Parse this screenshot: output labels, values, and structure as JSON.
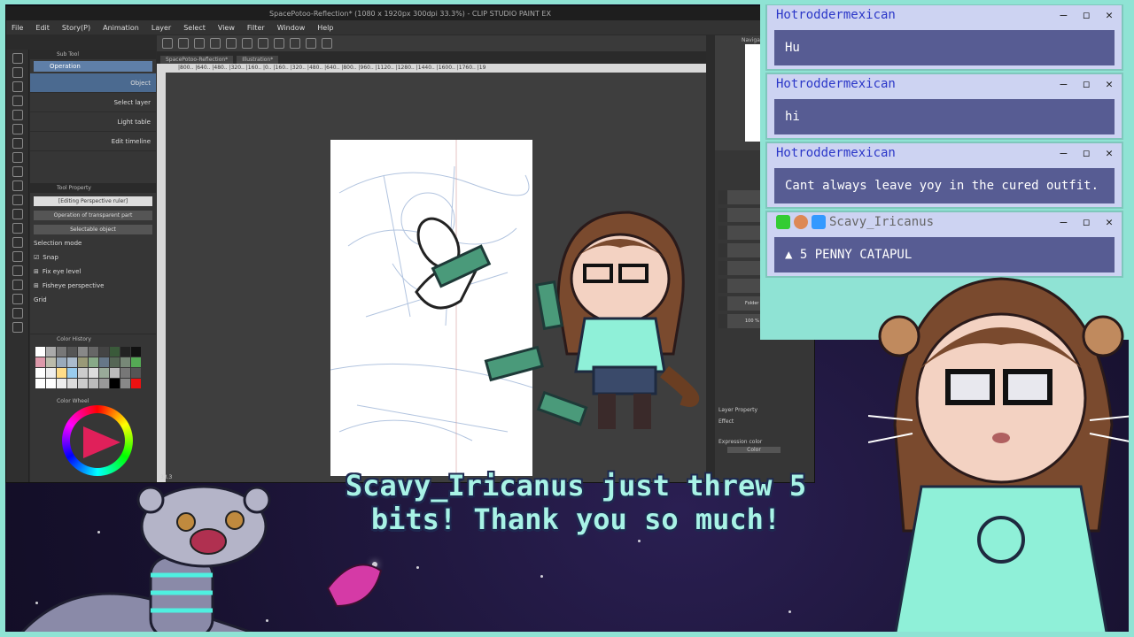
{
  "csp": {
    "title": "SpacePotoo-Reflection* (1080 x 1920px 300dpi 33.3%) - CLIP STUDIO PAINT EX",
    "menu": [
      "File",
      "Edit",
      "Story(P)",
      "Animation",
      "Layer",
      "Select",
      "View",
      "Filter",
      "Window",
      "Help"
    ],
    "subtool": {
      "header": "Sub Tool",
      "selected": "Operation",
      "items": [
        "Object",
        "Select layer",
        "Light table",
        "Edit timeline"
      ]
    },
    "toolprop": {
      "header": "Tool Property",
      "editing": "[Editing Perspective ruler]",
      "option1": "Operation of transparent part",
      "option2": "Selectable object",
      "selection_mode": "Selection mode",
      "checks": [
        "Snap",
        "Fix eye level",
        "Fisheye perspective"
      ],
      "grid": "Grid"
    },
    "color_history": "Color History",
    "color_wheel": "Color Wheel",
    "tabs": [
      "SpacePotoo-Reflection*",
      "Illustration*"
    ],
    "ruler_text": "|800.. |640.. |480.. |320.. |160.. |0.. |160.. |320.. |480.. |640.. |800.. |960.. |1120.. |1280.. |1440.. |1600.. |1760.. |19",
    "zoom": "33.3",
    "navigator": "Navigat",
    "layer_labels": [
      "100 % Nor",
      "Folder 10",
      "100 % Nor Perspective"
    ],
    "layer_property": "Layer Property",
    "effect": "Effect",
    "expression_color": "Expression color",
    "color_label": "Color"
  },
  "chat": {
    "messages": [
      {
        "user": "Hotroddermexican",
        "text": "Hu"
      },
      {
        "user": "Hotroddermexican",
        "text": "hi"
      },
      {
        "user": "Hotroddermexican",
        "text": "Cant always leave yoy in the cured outfit."
      },
      {
        "user": "Scavy_Iricanus",
        "text": "5 PENNY CATAPUL"
      }
    ],
    "ctrl_min": "–",
    "ctrl_max": "◻",
    "ctrl_close": "✕"
  },
  "alert": {
    "line1": "Scavy_Iricanus just threw 5",
    "line2": "bits! Thank you so much!"
  },
  "colors": {
    "frame": "#8fe3d4",
    "chat_bg": "#cdd3f2",
    "chat_text_bg": "#575c93",
    "username": "#2b37c8",
    "alert_text": "#a8f3e6"
  }
}
